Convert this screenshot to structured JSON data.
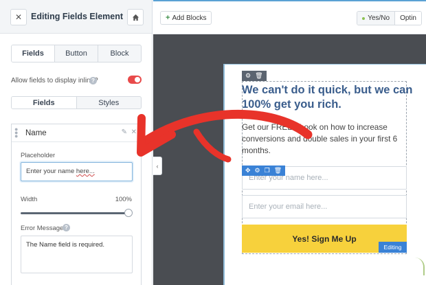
{
  "sidebar": {
    "title": "Editing Fields Element",
    "close_icon": "close-icon",
    "home_icon": "home-icon",
    "tabs": [
      {
        "label": "Fields",
        "active": true
      },
      {
        "label": "Button",
        "active": false
      },
      {
        "label": "Block",
        "active": false
      }
    ],
    "inline_label": "Allow fields to display inline?",
    "inline_enabled": false,
    "subtabs": [
      {
        "label": "Fields",
        "active": true
      },
      {
        "label": "Styles",
        "active": false
      }
    ],
    "field": {
      "name": "Name",
      "placeholder_label": "Placeholder",
      "placeholder_value_a": "Enter your name ",
      "placeholder_value_b": "here...",
      "width_label": "Width",
      "width_value": "100%",
      "width_fraction": 1.0,
      "error_label": "Error Message",
      "error_value": "The Name field is required."
    }
  },
  "toolbar": {
    "add_blocks": "Add Blocks",
    "yes_no": "Yes/No",
    "optin": "Optin"
  },
  "optin": {
    "headline": "We can't do it quick, but we can 100% get you rich.",
    "subtext": "Get our FREE ebook on how to increase conversions and double sales in your first 6 months.",
    "name_placeholder": "Enter your name here...",
    "email_placeholder": "Enter your email here...",
    "button": "Yes! Sign Me Up",
    "editing_tag": "Editing"
  },
  "colors": {
    "accent_red": "#e8332a",
    "headline_blue": "#3a5d8c",
    "cta_yellow": "#f7d13c",
    "edit_blue": "#3a82d6",
    "canvas_dark": "#4a4d52"
  }
}
